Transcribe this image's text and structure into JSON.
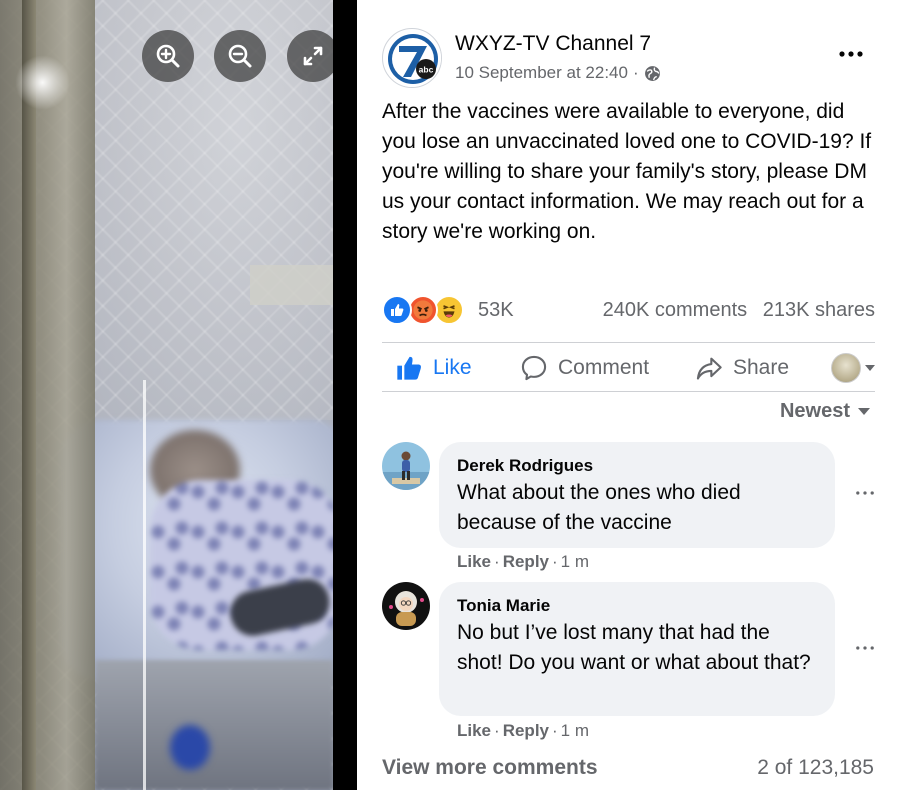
{
  "photo": {
    "controls": {
      "zoom_in_icon": "zoom-in-icon",
      "zoom_out_icon": "zoom-out-icon",
      "fullscreen_icon": "fullscreen-icon"
    }
  },
  "post": {
    "page_name": "WXYZ-TV Channel 7",
    "timestamp": "10 September at 22:40",
    "meta_separator": "·",
    "text": "After the vaccines were available to everyone, did you lose an unvaccinated loved one to COVID-19? If you're willing to share your family's story, please DM us your contact information. We may reach out for a story we're working on.",
    "reactions": {
      "types": [
        "like",
        "angry",
        "haha"
      ],
      "count": "53K",
      "comments": "240K comments",
      "shares": "213K shares"
    },
    "actions": {
      "like": "Like",
      "comment": "Comment",
      "share": "Share"
    },
    "sort_label": "Newest",
    "comments": [
      {
        "author": "Derek Rodrigues",
        "text": "What about the ones who died because of the vaccine",
        "like": "Like",
        "reply": "Reply",
        "time": "1 m"
      },
      {
        "author": "Tonia Marie",
        "text": "No but I’ve lost many that had the shot! Do you want or what about that?",
        "like": "Like",
        "reply": "Reply",
        "time": "1 m"
      }
    ],
    "view_more": "View more comments",
    "comment_count": "2 of 123,185"
  },
  "colors": {
    "facebook_blue": "#1877f2",
    "secondary_text": "#65676b",
    "bubble_bg": "#f0f2f5",
    "divider": "#ced0d4"
  }
}
